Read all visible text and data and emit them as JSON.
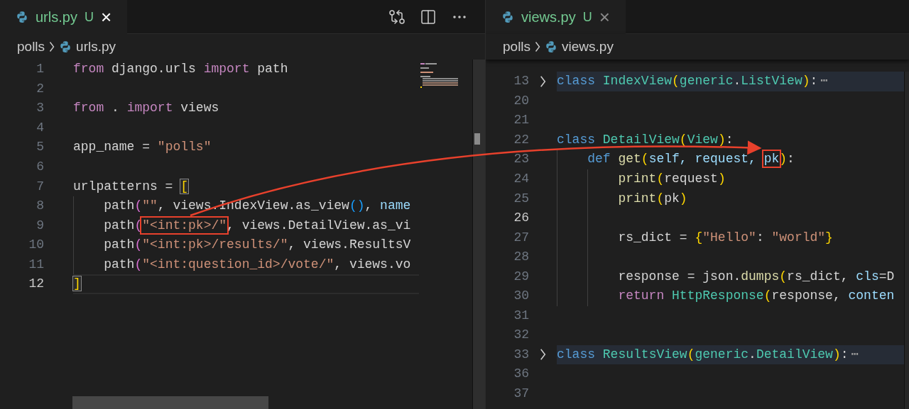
{
  "panes": [
    {
      "tab": {
        "name": "urls.py",
        "badge": "U",
        "close": "×",
        "selected": true,
        "focused": true
      },
      "actions": true,
      "breadcrumb": [
        "polls",
        "urls.py"
      ],
      "offset": false,
      "lines": [
        {
          "number": "1",
          "current": false,
          "tokens": [
            {
              "text": "from",
              "kind": "kw"
            },
            {
              "text": " django.urls ",
              "kind": "plain"
            },
            {
              "text": "import",
              "kind": "kw"
            },
            {
              "text": " path",
              "kind": "plain"
            }
          ]
        },
        {
          "number": "2",
          "current": false
        },
        {
          "number": "3",
          "current": false,
          "tokens": [
            {
              "text": "from",
              "kind": "kw"
            },
            {
              "text": " . ",
              "kind": "plain"
            },
            {
              "text": "import",
              "kind": "kw"
            },
            {
              "text": " views",
              "kind": "plain"
            }
          ]
        },
        {
          "number": "4",
          "current": false
        },
        {
          "number": "5",
          "current": false,
          "tokens": [
            {
              "text": "app_name = ",
              "kind": "plain"
            },
            {
              "text": "\"polls\"",
              "kind": "str"
            }
          ]
        },
        {
          "number": "6",
          "current": false
        },
        {
          "number": "7",
          "current": false,
          "tokens": [
            {
              "text": "urlpatterns = ",
              "kind": "plain"
            },
            {
              "text": "[",
              "kind": "match"
            }
          ]
        },
        {
          "number": "8",
          "current": false,
          "tokens": [
            {
              "text": "    path",
              "kind": "plain"
            },
            {
              "text": "(",
              "kind": "b2"
            },
            {
              "text": "\"\"",
              "kind": "str"
            },
            {
              "text": ", views.IndexView.as_view",
              "kind": "plain"
            },
            {
              "text": "()",
              "kind": "b3"
            },
            {
              "text": ", ",
              "kind": "plain"
            },
            {
              "text": "name",
              "kind": "param"
            }
          ]
        },
        {
          "number": "9",
          "current": false,
          "tokens": [
            {
              "text": "    path",
              "kind": "plain"
            },
            {
              "text": "(",
              "kind": "b2"
            },
            {
              "text": "\"<int:pk>/\"",
              "kind": "str",
              "boxed": true
            },
            {
              "text": ", views.DetailView.as_vi",
              "kind": "plain"
            }
          ]
        },
        {
          "number": "10",
          "current": false,
          "tokens": [
            {
              "text": "    path",
              "kind": "plain"
            },
            {
              "text": "(",
              "kind": "b2"
            },
            {
              "text": "\"<int:pk>/results/\"",
              "kind": "str"
            },
            {
              "text": ", views.ResultsV",
              "kind": "plain"
            }
          ]
        },
        {
          "number": "11",
          "current": false,
          "tokens": [
            {
              "text": "    path",
              "kind": "plain"
            },
            {
              "text": "(",
              "kind": "b2"
            },
            {
              "text": "\"<int:question_id>/vote/\"",
              "kind": "str"
            },
            {
              "text": ", views.vo",
              "kind": "plain"
            }
          ]
        },
        {
          "number": "12",
          "current": true,
          "tokens": [
            {
              "text": "]",
              "kind": "match"
            }
          ]
        }
      ]
    },
    {
      "tab": {
        "name": "views.py",
        "badge": "U",
        "close": "×",
        "selected": true,
        "focused": false
      },
      "actions": false,
      "breadcrumb": [
        "polls",
        "views.py"
      ],
      "offset": true,
      "lines": [
        {
          "number": "13",
          "current": false,
          "folded": true,
          "tokens": [
            {
              "text": "class",
              "kind": "storage"
            },
            {
              "text": " IndexView",
              "kind": "cls"
            },
            {
              "text": "(",
              "kind": "b1"
            },
            {
              "text": "generic",
              "kind": "cls"
            },
            {
              "text": ".",
              "kind": "plain"
            },
            {
              "text": "ListView",
              "kind": "cls"
            },
            {
              "text": ")",
              "kind": "b1"
            },
            {
              "text": ":",
              "kind": "plain"
            },
            {
              "text": "⋯",
              "kind": "fold"
            }
          ]
        },
        {
          "number": "20",
          "current": false,
          "folded": false
        },
        {
          "number": "21",
          "current": false,
          "folded": false
        },
        {
          "number": "22",
          "current": false,
          "folded": false,
          "tokens": [
            {
              "text": "class",
              "kind": "storage"
            },
            {
              "text": " DetailView",
              "kind": "cls"
            },
            {
              "text": "(",
              "kind": "b1"
            },
            {
              "text": "View",
              "kind": "cls"
            },
            {
              "text": ")",
              "kind": "b1"
            },
            {
              "text": ":",
              "kind": "plain"
            }
          ]
        },
        {
          "number": "23",
          "current": false,
          "folded": false,
          "tokens": [
            {
              "text": "    def",
              "kind": "storage"
            },
            {
              "text": " get",
              "kind": "fn"
            },
            {
              "text": "(",
              "kind": "b1"
            },
            {
              "text": "self, request, ",
              "kind": "param"
            },
            {
              "text": "pk",
              "kind": "param",
              "boxed": true
            },
            {
              "text": ")",
              "kind": "b1"
            },
            {
              "text": ":",
              "kind": "plain"
            }
          ]
        },
        {
          "number": "24",
          "current": false,
          "folded": false,
          "tokens": [
            {
              "text": "        print",
              "kind": "fn"
            },
            {
              "text": "(",
              "kind": "b1"
            },
            {
              "text": "request",
              "kind": "plain"
            },
            {
              "text": ")",
              "kind": "b1"
            }
          ]
        },
        {
          "number": "25",
          "current": false,
          "folded": false,
          "tokens": [
            {
              "text": "        print",
              "kind": "fn"
            },
            {
              "text": "(",
              "kind": "b1"
            },
            {
              "text": "pk",
              "kind": "plain"
            },
            {
              "text": ")",
              "kind": "b1"
            }
          ]
        },
        {
          "number": "26",
          "current": true,
          "folded": false
        },
        {
          "number": "27",
          "current": false,
          "folded": false,
          "tokens": [
            {
              "text": "        rs_dict = ",
              "kind": "plain"
            },
            {
              "text": "{",
              "kind": "b1"
            },
            {
              "text": "\"Hello\"",
              "kind": "str"
            },
            {
              "text": ": ",
              "kind": "plain"
            },
            {
              "text": "\"world\"",
              "kind": "str"
            },
            {
              "text": "}",
              "kind": "b1"
            }
          ]
        },
        {
          "number": "28",
          "current": false,
          "folded": false
        },
        {
          "number": "29",
          "current": false,
          "folded": false,
          "tokens": [
            {
              "text": "        response = json.",
              "kind": "plain"
            },
            {
              "text": "dumps",
              "kind": "fn"
            },
            {
              "text": "(",
              "kind": "b1"
            },
            {
              "text": "rs_dict, ",
              "kind": "plain"
            },
            {
              "text": "cls",
              "kind": "param"
            },
            {
              "text": "=D",
              "kind": "plain"
            }
          ]
        },
        {
          "number": "30",
          "current": false,
          "folded": false,
          "tokens": [
            {
              "text": "        return",
              "kind": "kw"
            },
            {
              "text": " HttpResponse",
              "kind": "cls"
            },
            {
              "text": "(",
              "kind": "b1"
            },
            {
              "text": "response, ",
              "kind": "plain"
            },
            {
              "text": "conten",
              "kind": "param"
            }
          ]
        },
        {
          "number": "31",
          "current": false,
          "folded": false
        },
        {
          "number": "32",
          "current": false,
          "folded": false
        },
        {
          "number": "33",
          "current": false,
          "folded": true,
          "tokens": [
            {
              "text": "class",
              "kind": "storage"
            },
            {
              "text": " ResultsView",
              "kind": "cls"
            },
            {
              "text": "(",
              "kind": "b1"
            },
            {
              "text": "generic",
              "kind": "cls"
            },
            {
              "text": ".",
              "kind": "plain"
            },
            {
              "text": "DetailView",
              "kind": "cls"
            },
            {
              "text": ")",
              "kind": "b1"
            },
            {
              "text": ":",
              "kind": "plain"
            },
            {
              "text": "⋯",
              "kind": "fold"
            }
          ]
        },
        {
          "number": "36",
          "current": false,
          "folded": false
        },
        {
          "number": "37",
          "current": false,
          "folded": false
        }
      ]
    }
  ],
  "annotation": {
    "kind": "arrow"
  }
}
